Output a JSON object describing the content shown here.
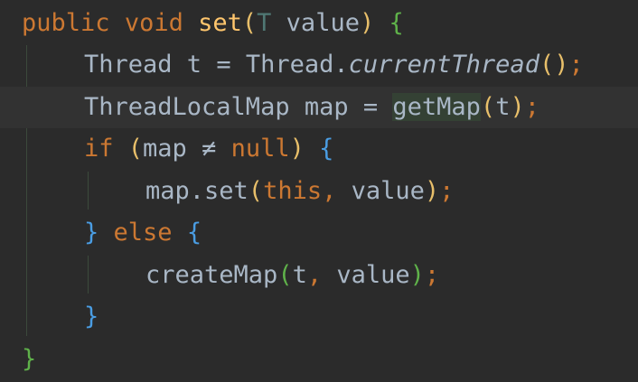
{
  "editor": {
    "lines": {
      "l1": {
        "public": "public",
        "void": "void",
        "method": "set",
        "open_paren": "(",
        "type_param": "T",
        "param": " value",
        "close_paren": ")",
        "open_brace": "{"
      },
      "l2": {
        "type": "Thread",
        "var": " t = Thread.",
        "method": "currentThread",
        "parens": "()",
        "semi": ";"
      },
      "l3": {
        "type_and_var": "ThreadLocalMap map = ",
        "method": "getMap",
        "open_paren": "(",
        "arg": "t",
        "close_paren": ")",
        "semi": ";"
      },
      "l4": {
        "if": "if",
        "open_paren": "(",
        "cond": "map ≠ ",
        "null": "null",
        "close_paren": ")",
        "open_brace": "{"
      },
      "l5": {
        "target": "map.set",
        "open_paren": "(",
        "this": "this",
        "comma": ",",
        "arg": " value",
        "close_paren": ")",
        "semi": ";"
      },
      "l6": {
        "close_brace": "}",
        "else": "else",
        "open_brace": "{"
      },
      "l7": {
        "method": "createMap",
        "open_paren": "(",
        "arg1": "t",
        "comma": ",",
        "arg2": " value",
        "close_paren": ")",
        "semi": ";"
      },
      "l8": {
        "close_brace": "}"
      },
      "l9": {
        "close_brace": "}"
      }
    },
    "colors": {
      "background": "#2b2b2b",
      "current_line": "#323232",
      "keyword": "#cc7832",
      "method_declaration": "#ffc66d",
      "identifier": "#a9b7c6",
      "bracket_level_1": "#e8bf6a",
      "bracket_level_2": "#5fb24a",
      "bracket_level_3": "#4a9de3",
      "usage_highlight": "#344134"
    }
  }
}
